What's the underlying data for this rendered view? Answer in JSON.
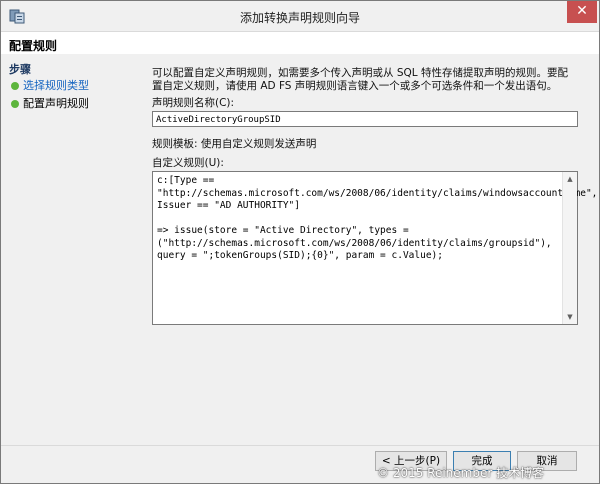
{
  "window": {
    "title": "添加转换声明规则向导",
    "close_glyph": "✕"
  },
  "page": {
    "heading": "配置规则"
  },
  "steps": {
    "title": "步骤",
    "items": [
      {
        "label": "选择规则类型",
        "link": true
      },
      {
        "label": "配置声明规则",
        "link": false
      }
    ]
  },
  "main": {
    "description": "可以配置自定义声明规则，如需要多个传入声明或从 SQL 特性存储提取声明的规则。要配置自定义规则，请使用 AD FS 声明规则语言键入一个或多个可选条件和一个发出语句。",
    "rule_name_label": "声明规则名称(C):",
    "rule_name_value": "ActiveDirectoryGroupSID",
    "template_label": "规则模板: 使用自定义规则发送声明",
    "custom_rule_label": "自定义规则(U):",
    "custom_rule_text": "c:[Type ==\n\"http://schemas.microsoft.com/ws/2008/06/identity/claims/windowsaccountname\", Issuer == \"AD AUTHORITY\"]\n\n=> issue(store = \"Active Directory\", types =\n(\"http://schemas.microsoft.com/ws/2008/06/identity/claims/groupsid\"),\nquery = \";tokenGroups(SID);{0}\", param = c.Value);"
  },
  "buttons": {
    "previous": "< 上一步(P)",
    "finish": "完成",
    "cancel": "取消"
  },
  "watermark": "© 2015 Reinember 技术博客",
  "colors": {
    "link": "#1665c1",
    "step_dot": "#5cb53c",
    "close": "#c75050"
  }
}
